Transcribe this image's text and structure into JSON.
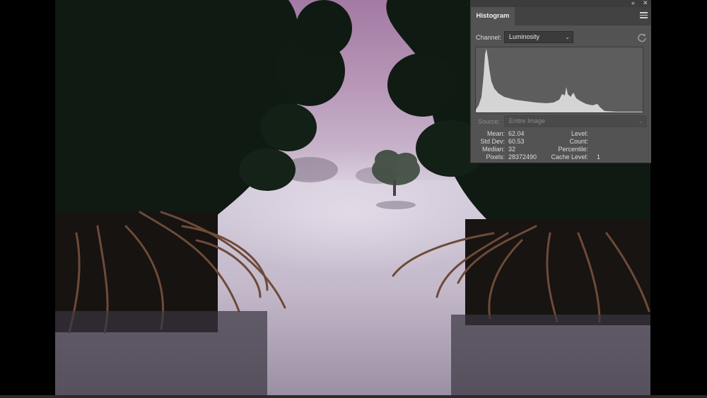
{
  "panel": {
    "title": "Histogram",
    "collapse_glyph": "«",
    "close_glyph": "✕",
    "menu_icon": "hamburger-menu-icon",
    "refresh_icon": "refresh-icon"
  },
  "channel": {
    "label": "Channel:",
    "value": "Luminosity",
    "chevron": "⌄"
  },
  "source": {
    "label": "Source:",
    "value": "Entire Image",
    "chevron": "⌄"
  },
  "stats": {
    "mean": {
      "label": "Mean:",
      "value": "62.04"
    },
    "std_dev": {
      "label": "Std Dev:",
      "value": "60.53"
    },
    "median": {
      "label": "Median:",
      "value": "32"
    },
    "pixels": {
      "label": "Pixels:",
      "value": "28372490"
    },
    "level": {
      "label": "Level:",
      "value": ""
    },
    "count": {
      "label": "Count:",
      "value": ""
    },
    "percentile": {
      "label": "Percentile:",
      "value": ""
    },
    "cache_level": {
      "label": "Cache Level:",
      "value": "1"
    }
  },
  "colors": {
    "panel_bg": "#535353",
    "histogram_fill": "#d4d4d4",
    "sky_top": "#a87fa8",
    "water": "#c9c0d2",
    "foliage": "#0f1a12",
    "roots": "#6e4a38"
  }
}
